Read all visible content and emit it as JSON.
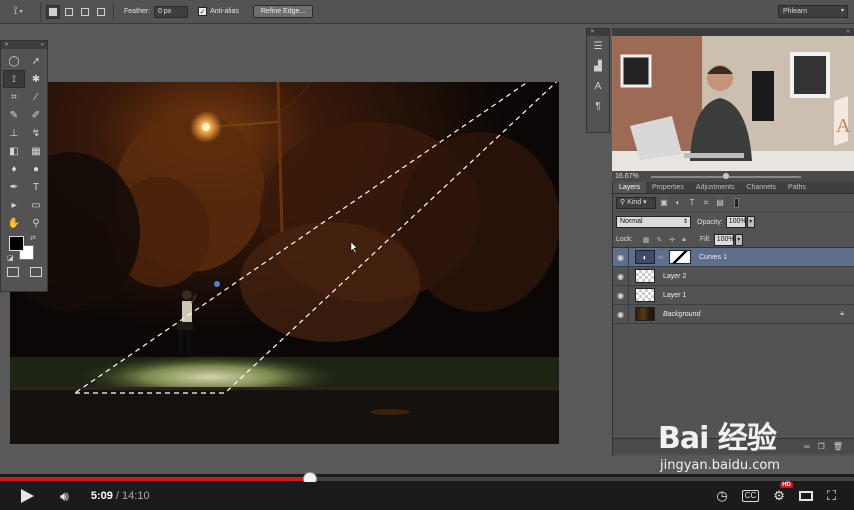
{
  "options_bar": {
    "feather_label": "Feather:",
    "feather_value": "0 px",
    "antialias_label": "Anti-alias",
    "antialias_checked": true,
    "refine_edge_label": "Refine Edge...",
    "workspace": "Phlearn"
  },
  "tools": {
    "icons": [
      "marquee-icon",
      "move-icon",
      "lasso-icon",
      "magic-wand-icon",
      "crop-icon",
      "eyedropper-icon",
      "healing-brush-icon",
      "brush-icon",
      "clone-stamp-icon",
      "history-brush-icon",
      "eraser-icon",
      "gradient-icon",
      "blur-icon",
      "dodge-icon",
      "pen-icon",
      "type-icon",
      "path-select-icon",
      "shape-icon",
      "hand-icon",
      "zoom-icon"
    ],
    "foreground_color": "#000000",
    "background_color": "#ffffff"
  },
  "webcam": {
    "zoom_value": "16.67%"
  },
  "layers_panel": {
    "tabs": [
      "Layers",
      "Properties",
      "Adjustments",
      "Channels",
      "Paths"
    ],
    "active_tab": "Layers",
    "filter_kind": "Kind",
    "blend_mode": "Normal",
    "opacity_label": "Opacity:",
    "opacity_value": "100%",
    "lock_label": "Lock:",
    "fill_label": "Fill:",
    "fill_value": "100%",
    "layers": [
      {
        "name": "Curves 1",
        "selected": true
      },
      {
        "name": "Layer 2",
        "selected": false
      },
      {
        "name": "Layer 1",
        "selected": false
      },
      {
        "name": "Background",
        "selected": false,
        "locked": true
      }
    ]
  },
  "player": {
    "current_time": "5:09",
    "separator": " / ",
    "duration": "14:10",
    "progress": 0.363,
    "hd_label": "HD"
  },
  "watermark": {
    "brand": "Bai 经验",
    "url": "jingyan.baidu.com"
  },
  "colors": {
    "accent_red": "#cc181e",
    "panel_gray": "#535353",
    "selection_blue": "#5d6f8a",
    "streetlight": "#ffb04a"
  }
}
